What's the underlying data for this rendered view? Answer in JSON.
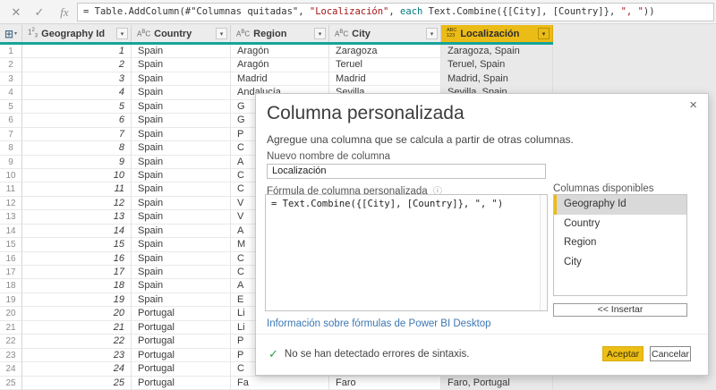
{
  "colors": {
    "accent_teal": "#16a49a",
    "brand_gold": "#ebbb16",
    "link_blue": "#3c78b4",
    "string_red": "#a31515",
    "keyword_teal": "#00797b",
    "success_green": "#2e9e44"
  },
  "icons": {
    "discard": "✕",
    "commit": "✓",
    "fx": "fx",
    "dropdown": "▾",
    "table_corner": "⊞",
    "info": "ⓘ",
    "check": "✓",
    "close": "×"
  },
  "formula_bar": {
    "segments": [
      {
        "t": "= Table.AddColumn(#\"Columnas quitadas\", ",
        "c": "code"
      },
      {
        "t": "\"Localización\"",
        "c": "string"
      },
      {
        "t": ", ",
        "c": "code"
      },
      {
        "t": "each",
        "c": "keyword"
      },
      {
        "t": " Text.Combine({[City], [Country]}, ",
        "c": "code"
      },
      {
        "t": "\", \"",
        "c": "string"
      },
      {
        "t": "))",
        "c": "code"
      }
    ]
  },
  "table": {
    "columns": [
      {
        "name": "Geography Id",
        "type": "number"
      },
      {
        "name": "Country",
        "type": "text"
      },
      {
        "name": "Region",
        "type": "text"
      },
      {
        "name": "City",
        "type": "text"
      },
      {
        "name": "Localización",
        "type": "any",
        "selected": true
      }
    ],
    "rows": [
      [
        "1",
        "Spain",
        "Aragón",
        "Zaragoza",
        "Zaragoza, Spain"
      ],
      [
        "2",
        "Spain",
        "Aragón",
        "Teruel",
        "Teruel, Spain"
      ],
      [
        "3",
        "Spain",
        "Madrid",
        "Madrid",
        "Madrid, Spain"
      ],
      [
        "4",
        "Spain",
        "Andalucía",
        "Sevilla",
        "Sevilla, Spain"
      ],
      [
        "5",
        "Spain",
        "G",
        "",
        ""
      ],
      [
        "6",
        "Spain",
        "G",
        "",
        ""
      ],
      [
        "7",
        "Spain",
        "P",
        "",
        ""
      ],
      [
        "8",
        "Spain",
        "C",
        "",
        ""
      ],
      [
        "9",
        "Spain",
        "A",
        "",
        ""
      ],
      [
        "10",
        "Spain",
        "C",
        "",
        ""
      ],
      [
        "11",
        "Spain",
        "C",
        "",
        ""
      ],
      [
        "12",
        "Spain",
        "V",
        "",
        ""
      ],
      [
        "13",
        "Spain",
        "V",
        "",
        ""
      ],
      [
        "14",
        "Spain",
        "A",
        "",
        ""
      ],
      [
        "15",
        "Spain",
        "M",
        "",
        ""
      ],
      [
        "16",
        "Spain",
        "C",
        "",
        ""
      ],
      [
        "17",
        "Spain",
        "C",
        "",
        ""
      ],
      [
        "18",
        "Spain",
        "A",
        "",
        ""
      ],
      [
        "19",
        "Spain",
        "E",
        "",
        ""
      ],
      [
        "20",
        "Portugal",
        "Li",
        "",
        ""
      ],
      [
        "21",
        "Portugal",
        "Li",
        "",
        ""
      ],
      [
        "22",
        "Portugal",
        "P",
        "",
        ""
      ],
      [
        "23",
        "Portugal",
        "P",
        "",
        ""
      ],
      [
        "24",
        "Portugal",
        "C",
        "",
        ""
      ],
      [
        "25",
        "Portugal",
        "Fa",
        "Faro",
        "Faro, Portugal"
      ]
    ]
  },
  "dialog": {
    "title": "Columna personalizada",
    "description": "Agregue una columna que se calcula a partir de otras columnas.",
    "name_label": "Nuevo nombre de columna",
    "name_value": "Localización",
    "formula_label": "Fórmula de columna personalizada",
    "formula_value": "= Text.Combine({[City], [Country]}, \", \")",
    "columns_label": "Columnas disponibles",
    "available_columns": [
      "Geography Id",
      "Country",
      "Region",
      "City"
    ],
    "selected_column": "Geography Id",
    "insert_button": "<< Insertar",
    "link": "Información sobre fórmulas de Power BI Desktop",
    "status": "No se han detectado errores de sintaxis.",
    "accept_button": "Aceptar",
    "cancel_button": "Cancelar"
  }
}
